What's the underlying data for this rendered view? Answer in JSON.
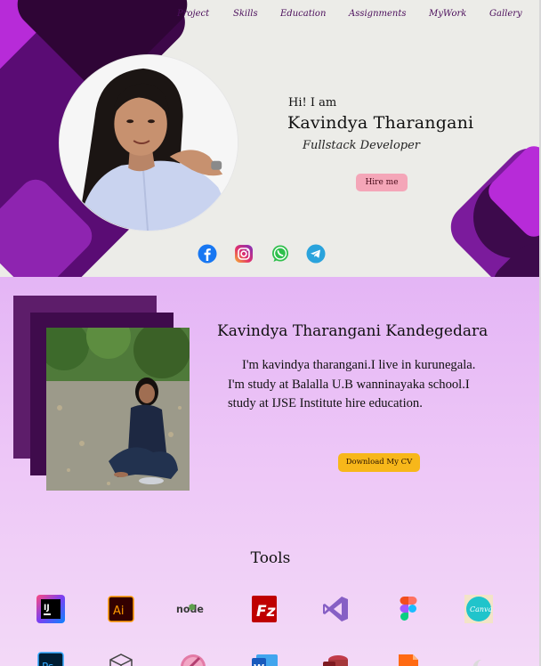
{
  "nav": {
    "items": [
      "Project",
      "Skills",
      "Education",
      "Assignments",
      "MyWork",
      "Gallery"
    ]
  },
  "hero": {
    "greeting": "Hi! I am",
    "name": "Kavindya Tharangani",
    "role": "Fullstack Developer",
    "hire_label": "Hire me",
    "social": [
      "facebook-icon",
      "instagram-icon",
      "whatsapp-icon",
      "telegram-icon"
    ]
  },
  "about": {
    "full_name": "Kavindya Tharangani Kandegedara",
    "bio": "I'm kavindya tharangani.I live in kurunegala. I'm study at Balalla U.B wanninayaka school.I study at IJSE Institute hire education.",
    "cv_label": "Download My CV"
  },
  "tools": {
    "title": "Tools",
    "row1": [
      "intellij-icon",
      "illustrator-icon",
      "nodejs-icon",
      "filezilla-icon",
      "visual-studio-icon",
      "figma-icon",
      "canva-icon"
    ],
    "row2": [
      "photoshop-icon",
      "box-icon",
      "gimp-icon",
      "word-icon",
      "access-icon",
      "file-icon",
      "moon-icon"
    ],
    "canva_label": "Canva",
    "ij_label": "IJ",
    "ai_label": "Ai",
    "node_label": "node",
    "ps_label": "Ps",
    "w_label": "W"
  },
  "colors": {
    "hero_bg": "#ecece8",
    "purple_dark": "#3f0b4c",
    "purple_mid": "#5a0c74",
    "magenta": "#b72bd8",
    "about_bg": "#e4b5f5",
    "hire_btn": "#f4a6b8",
    "cv_btn": "#f7b71a"
  }
}
